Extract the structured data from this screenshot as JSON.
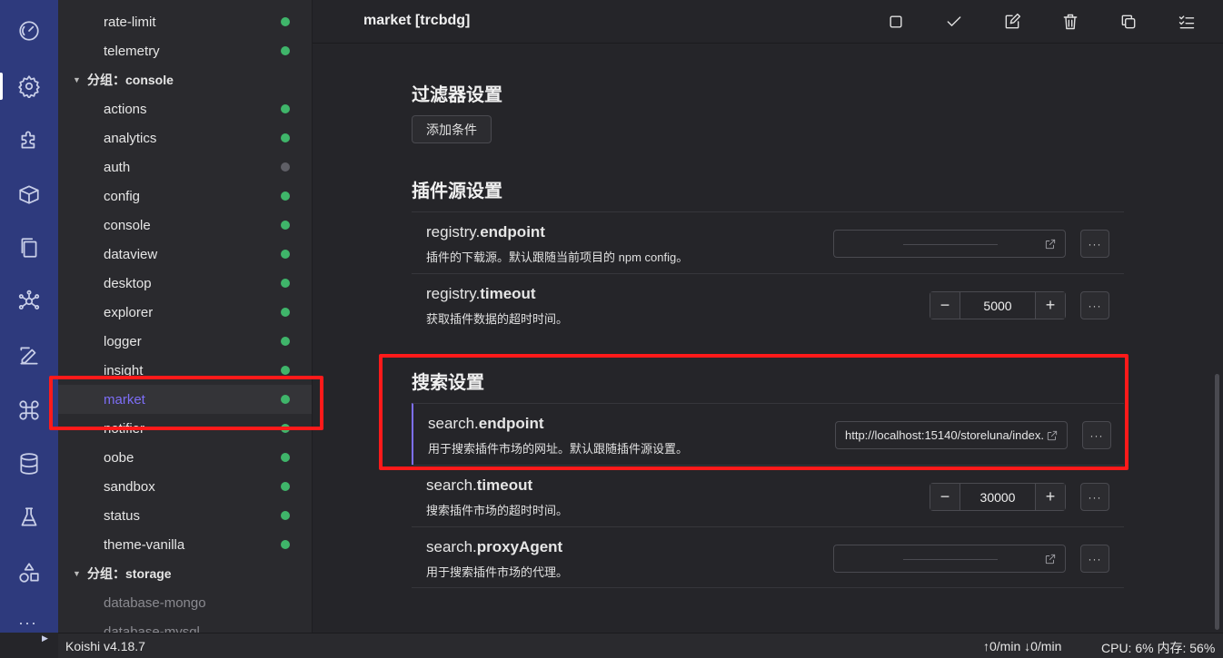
{
  "sidebar": {
    "items": [
      {
        "label": "rate-limit",
        "status": "active"
      },
      {
        "label": "telemetry",
        "status": "active"
      },
      {
        "label": "分组：console",
        "group": true
      },
      {
        "label": "actions",
        "status": "active"
      },
      {
        "label": "analytics",
        "status": "active"
      },
      {
        "label": "auth",
        "status": "inactive"
      },
      {
        "label": "config",
        "status": "active"
      },
      {
        "label": "console",
        "status": "active"
      },
      {
        "label": "dataview",
        "status": "active"
      },
      {
        "label": "desktop",
        "status": "active"
      },
      {
        "label": "explorer",
        "status": "active"
      },
      {
        "label": "logger",
        "status": "active"
      },
      {
        "label": "insight",
        "status": "active"
      },
      {
        "label": "market",
        "status": "active",
        "selected": true
      },
      {
        "label": "notifier",
        "status": "active"
      },
      {
        "label": "oobe",
        "status": "active"
      },
      {
        "label": "sandbox",
        "status": "active"
      },
      {
        "label": "status",
        "status": "active"
      },
      {
        "label": "theme-vanilla",
        "status": "active"
      },
      {
        "label": "分组：storage",
        "group": true
      },
      {
        "label": "database-mongo",
        "status": "none"
      },
      {
        "label": "database-mysql",
        "status": "none"
      }
    ]
  },
  "header": {
    "title": "market [trcbdg]"
  },
  "sections": {
    "filter": {
      "title": "过滤器设置",
      "add_button": "添加条件"
    },
    "plugin_source": {
      "title": "插件源设置"
    },
    "search": {
      "title": "搜索设置"
    }
  },
  "settings": {
    "registry_endpoint": {
      "prefix": "registry.",
      "key": "endpoint",
      "desc": "插件的下载源。默认跟随当前项目的 npm config。",
      "value": ""
    },
    "registry_timeout": {
      "prefix": "registry.",
      "key": "timeout",
      "desc": "获取插件数据的超时时间。",
      "value": "5000"
    },
    "search_endpoint": {
      "prefix": "search.",
      "key": "endpoint",
      "desc": "用于搜索插件市场的网址。默认跟随插件源设置。",
      "value": "http://localhost:15140/storeluna/index.json"
    },
    "search_timeout": {
      "prefix": "search.",
      "key": "timeout",
      "desc": "搜索插件市场的超时时间。",
      "value": "30000"
    },
    "search_proxy": {
      "prefix": "search.",
      "key": "proxyAgent",
      "desc": "用于搜索插件市场的代理。",
      "value": ""
    }
  },
  "controls": {
    "minus": "−",
    "plus": "+",
    "more": "···"
  },
  "statusbar": {
    "version": "Koishi v4.18.7",
    "network": "↑0/min ↓0/min",
    "resources": "CPU: 6% 内存: 56%"
  },
  "colors": {
    "accent": "#7d6ef7",
    "activity_bar": "#2e3a7d",
    "status_on": "#3fb56a",
    "status_off": "#5f5f66",
    "highlight": "#ff1a1a"
  }
}
